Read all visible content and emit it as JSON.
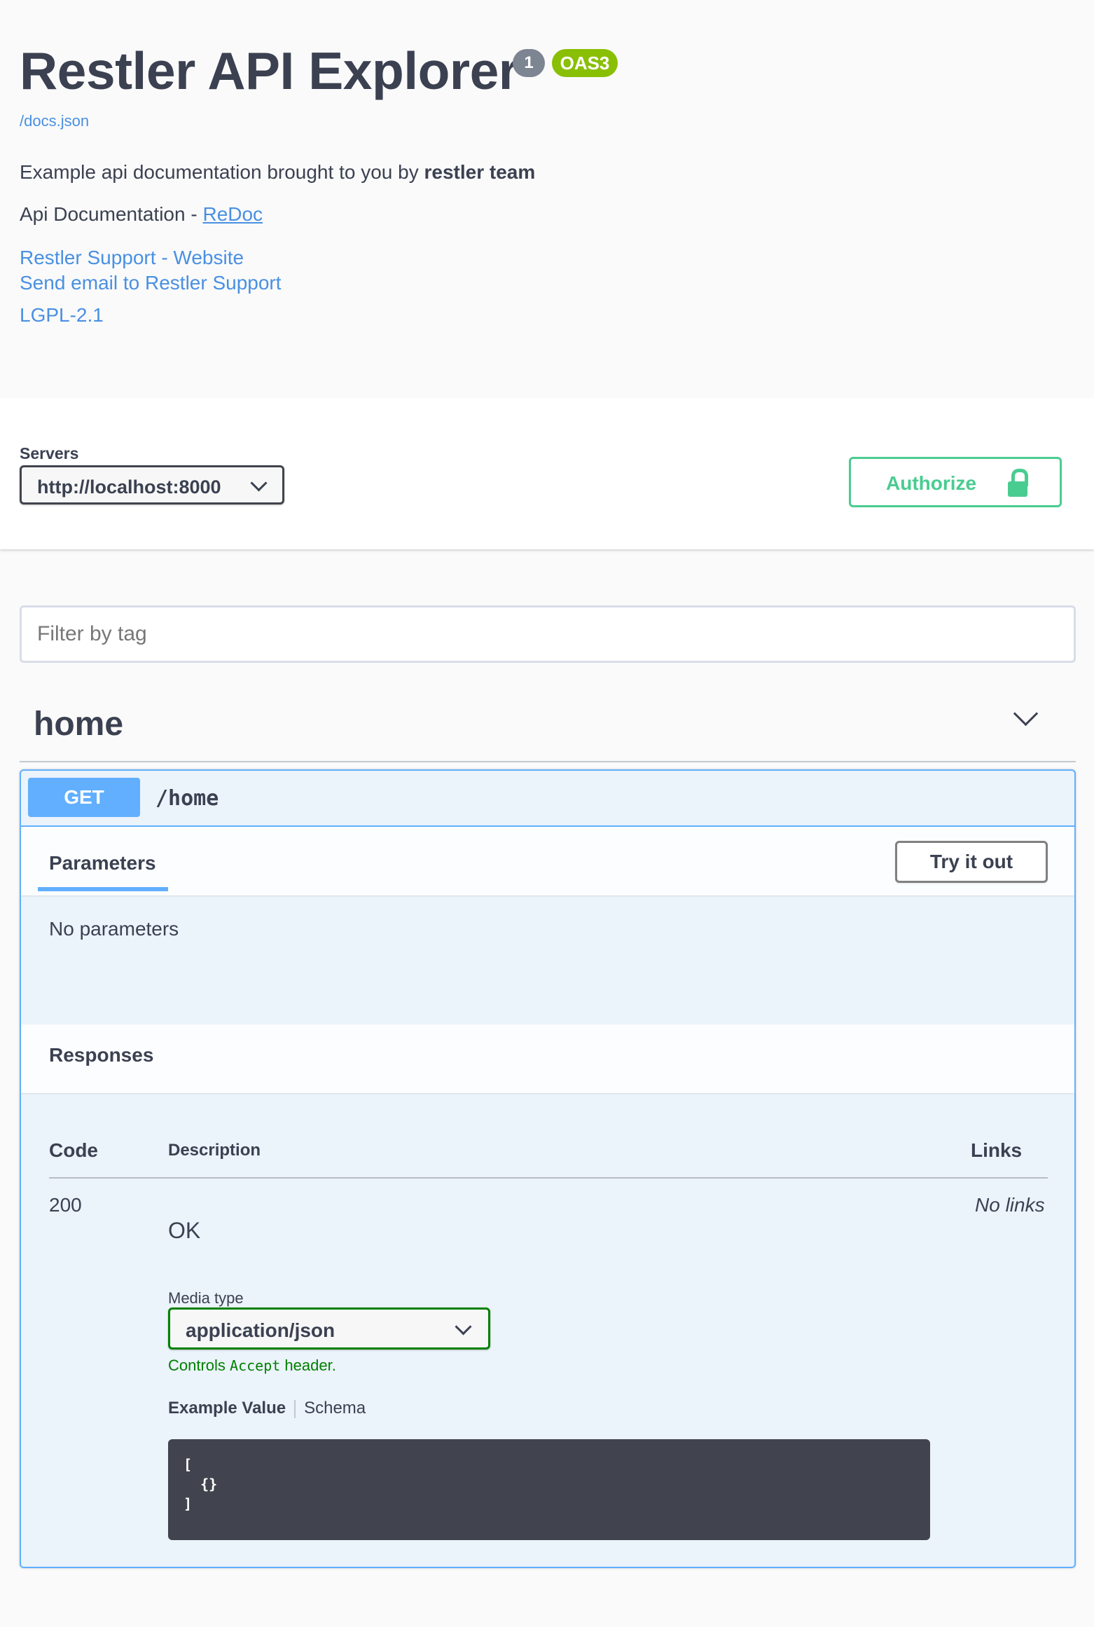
{
  "info": {
    "title": "Restler API Explorer",
    "version_badge": "1",
    "oas_badge": "OAS3",
    "docs_link": "/docs.json",
    "description_prefix": "Example api documentation brought to you by ",
    "description_bold": "restler team",
    "api_doc_prefix": "Api Documentation - ",
    "api_doc_link": "ReDoc",
    "support_website": "Restler Support - Website",
    "support_email": "Send email to Restler Support",
    "license": "LGPL-2.1"
  },
  "servers": {
    "label": "Servers",
    "selected": "http://localhost:8000"
  },
  "authorize": {
    "label": "Authorize"
  },
  "filter": {
    "placeholder": "Filter by tag"
  },
  "tag": {
    "name": "home"
  },
  "operation": {
    "method": "GET",
    "path": "/home",
    "params_tab": "Parameters",
    "try_it_out": "Try it out",
    "no_params": "No parameters",
    "responses_title": "Responses",
    "columns": {
      "code": "Code",
      "description": "Description",
      "links": "Links"
    },
    "responses": [
      {
        "code": "200",
        "description": "OK",
        "links": "No links"
      }
    ],
    "media_type_label": "Media type",
    "media_type": "application/json",
    "media_hint_prefix": "Controls ",
    "media_hint_code": "Accept",
    "media_hint_suffix": " header.",
    "example_tab": "Example Value",
    "schema_tab": "Schema",
    "example_code": "[\n  {}\n]"
  },
  "colors": {
    "get": "#61affe",
    "authorize": "#49cc90",
    "oas": "#89bf04",
    "link": "#4990e2"
  }
}
